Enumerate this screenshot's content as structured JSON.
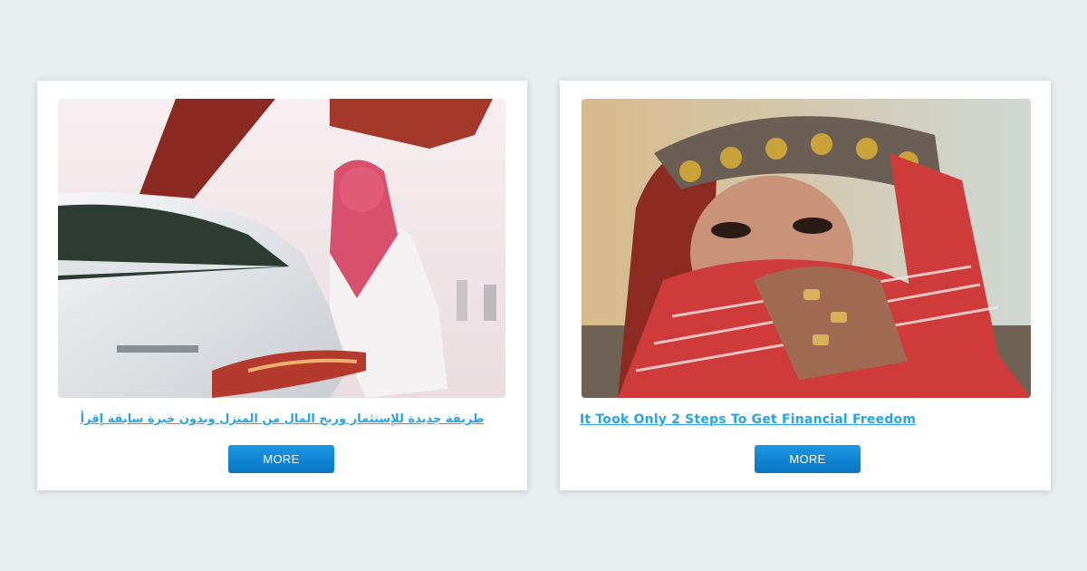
{
  "cards": [
    {
      "headline": "طريقة جديدة للإستثمار وربح المال من المنزل وبدون خبرة سابقة إقرأ",
      "button_label": "MORE",
      "image": "man-in-keffiyeh-leaning-on-white-amg-sports-car"
    },
    {
      "headline": "It Took Only 2 Steps To Get Financial Freedom",
      "button_label": "MORE",
      "image": "woman-in-gold-headdress-covering-face-with-red-keffiyeh"
    }
  ],
  "colors": {
    "background": "#e8eef0",
    "link": "#27a3e6",
    "button": "#0e86d3"
  }
}
